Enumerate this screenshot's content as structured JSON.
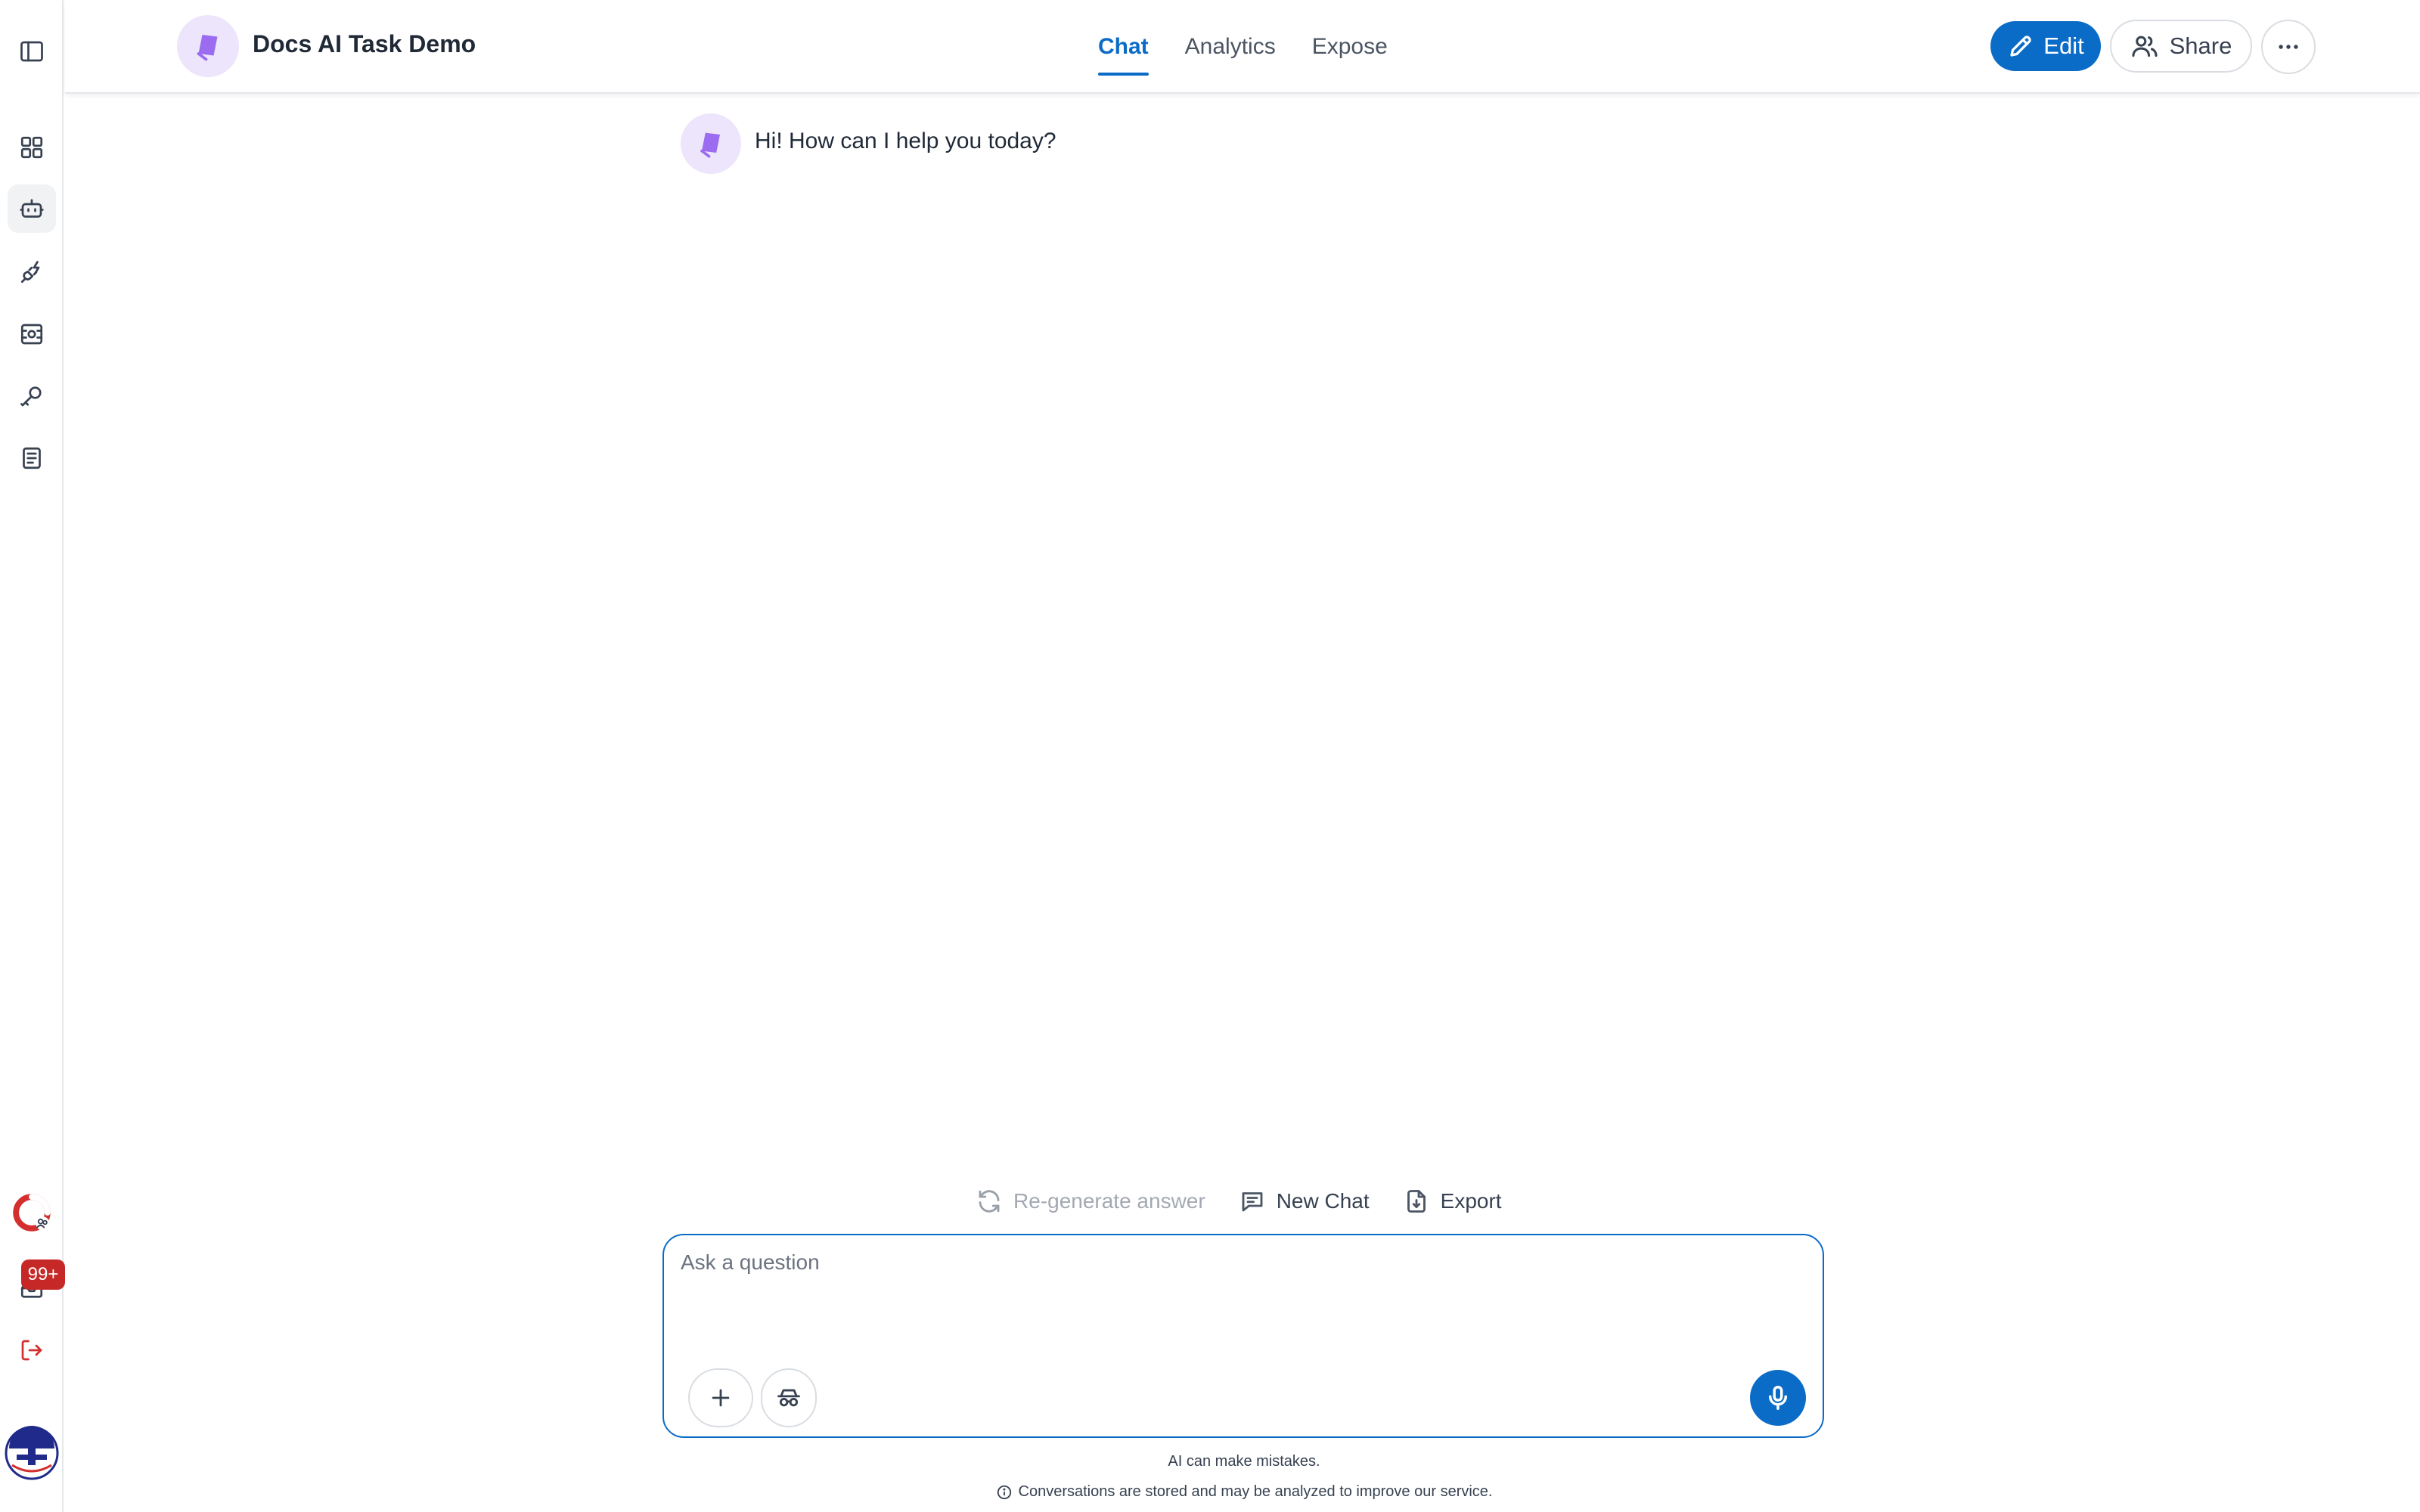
{
  "header": {
    "app_title": "Docs AI Task Demo",
    "tabs": [
      {
        "label": "Chat",
        "active": true
      },
      {
        "label": "Analytics",
        "active": false
      },
      {
        "label": "Expose",
        "active": false
      }
    ],
    "edit_label": "Edit",
    "share_label": "Share"
  },
  "sidebar": {
    "items": [
      {
        "icon": "sidebar-toggle-icon"
      },
      {
        "icon": "dashboard-grid-icon"
      },
      {
        "icon": "bot-icon",
        "active": true
      },
      {
        "icon": "plug-icon"
      },
      {
        "icon": "scan-icon"
      },
      {
        "icon": "key-icon"
      },
      {
        "icon": "document-list-icon"
      },
      {
        "icon": "support-lifebuoy-icon"
      },
      {
        "icon": "inbox-icon"
      },
      {
        "icon": "logout-icon"
      }
    ],
    "inbox_badge": "99+"
  },
  "chat": {
    "messages": [
      {
        "role": "assistant",
        "text": "Hi! How can I help you today?"
      }
    ]
  },
  "actions": {
    "regenerate_label": "Re-generate answer",
    "new_chat_label": "New Chat",
    "export_label": "Export"
  },
  "composer": {
    "placeholder": "Ask a question",
    "value": ""
  },
  "footer": {
    "disclaimer_1": "AI can make mistakes.",
    "disclaimer_2": "Conversations are stored and may be analyzed to improve our service."
  },
  "colors": {
    "accent": "#0b6cc7",
    "badge": "#c62828",
    "avatar_bg": "#ede5fb",
    "avatar_logo": "#9b6cf0"
  }
}
